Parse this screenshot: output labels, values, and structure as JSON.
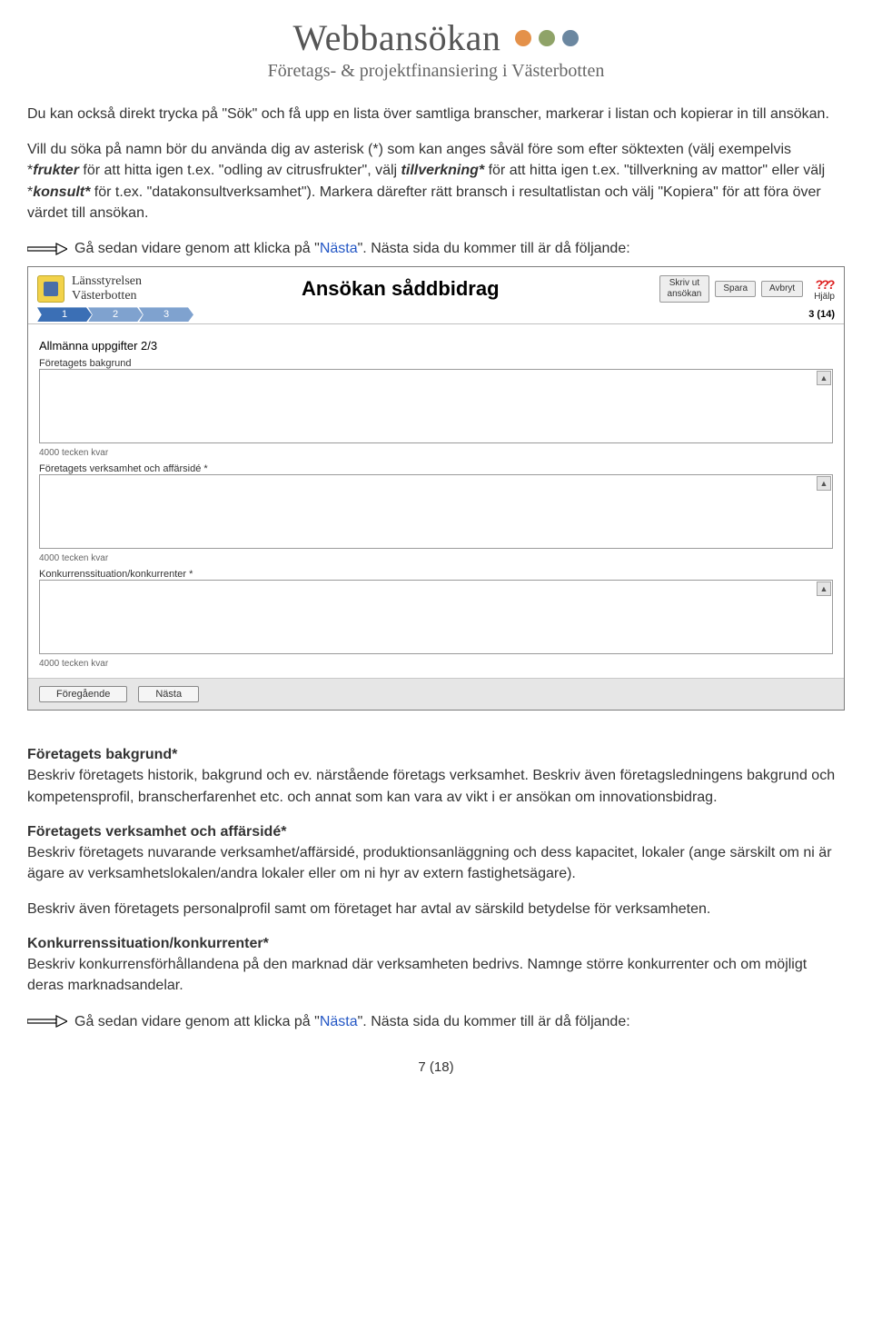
{
  "header": {
    "brand": "Webbansökan",
    "subtitle": "Företags- & projektfinansiering i Västerbotten"
  },
  "instructions": {
    "p1": "Du kan också direkt trycka på \"Sök\" och få upp en lista över samtliga branscher, markerar i listan och kopierar in till ansökan.",
    "p2_pre": "Vill du söka på namn bör du använda dig av asterisk (*) som kan anges såväl före som efter söktexten (välj exempelvis *",
    "p2_b1": "frukter",
    "p2_mid1": " för att hitta igen t.ex. \"odling av citrusfrukter\", välj ",
    "p2_b2": "tillverkning*",
    "p2_mid2": " för att hitta igen t.ex. \"tillverkning av mattor\" eller välj *",
    "p2_b3": "konsult*",
    "p2_end": " för t.ex. \"datakonsultverksamhet\"). Markera därefter rätt bransch i resultatlistan och välj \"Kopiera\" för att föra över värdet till ansökan.",
    "arrow1_pre": "Gå sedan vidare genom att klicka på \"",
    "arrow1_link": "Nästa",
    "arrow1_post": "\". Nästa sida du kommer till är då följande:"
  },
  "app": {
    "org_l1": "Länsstyrelsen",
    "org_l2": "Västerbotten",
    "title": "Ansökan såddbidrag",
    "btn_print": "Skriv ut\nansökan",
    "btn_save": "Spara",
    "btn_cancel": "Avbryt",
    "help_label": "Hjälp",
    "steps": [
      "1",
      "2",
      "3"
    ],
    "page_count": "3 (14)",
    "section": "Allmänna uppgifter 2/3",
    "fields": [
      {
        "label": "Företagets bakgrund",
        "hint": "4000 tecken kvar"
      },
      {
        "label": "Företagets verksamhet och affärsidé *",
        "hint": "4000 tecken kvar"
      },
      {
        "label": "Konkurrenssituation/konkurrenter *",
        "hint": "4000 tecken kvar"
      }
    ],
    "nav_prev": "Föregående",
    "nav_next": "Nästa"
  },
  "explain": {
    "h1": "Företagets bakgrund*",
    "h1_p": "Beskriv företagets historik, bakgrund och ev. närstående företags verksamhet. Beskriv även företagsledningens bakgrund och kompetensprofil, branscherfarenhet etc. och annat som kan vara av vikt i er ansökan om innovationsbidrag.",
    "h2": "Företagets verksamhet och affärsidé*",
    "h2_p1": "Beskriv företagets nuvarande verksamhet/affärsidé, produktionsanläggning och dess kapacitet, lokaler (ange särskilt om ni är ägare av verksamhetslokalen/andra lokaler eller om ni hyr av extern fastighetsägare).",
    "h2_p2": "Beskriv även företagets personalprofil samt om företaget har avtal av särskild betydelse för verksamheten.",
    "h3": "Konkurrenssituation/konkurrenter*",
    "h3_p": "Beskriv konkurrensförhållandena på den marknad där verksamheten bedrivs. Namnge större konkurrenter och om möjligt deras marknadsandelar.",
    "arrow2_pre": "Gå sedan vidare genom att klicka på \"",
    "arrow2_link": "Nästa",
    "arrow2_post": "\". Nästa sida du kommer till är då följande:"
  },
  "page_number": "7 (18)"
}
